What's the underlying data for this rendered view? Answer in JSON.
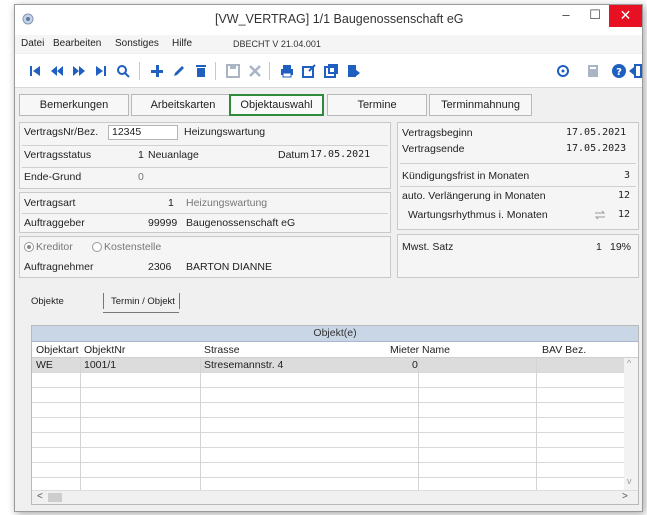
{
  "window": {
    "title": "[VW_VERTRAG]  1/1  Baugenossenschaft eG",
    "controls": {
      "minimize": "–",
      "maximize": "☐",
      "close": "✕"
    }
  },
  "menu": {
    "items": [
      "Datei",
      "Bearbeiten",
      "Sonstiges",
      "Hilfe"
    ],
    "version": "DBECHT V 21.04.001"
  },
  "toolbar": {
    "icons": [
      "first-record-icon",
      "previous-page-icon",
      "next-page-icon",
      "last-record-icon",
      "search-icon",
      "add-icon",
      "edit-icon",
      "delete-icon",
      "save-icon",
      "cancel-icon",
      "print-icon",
      "export-icon",
      "copy-icon",
      "import-icon",
      "refresh-icon",
      "calculator-icon",
      "help-icon",
      "exit-icon"
    ],
    "colors": {
      "primary": "#1f5fc0",
      "disabled": "#a9b4c4"
    }
  },
  "tabs": [
    {
      "label": "Bemerkungen",
      "active": false
    },
    {
      "label": "Arbeitskarten",
      "active": false
    },
    {
      "label": "Objektauswahl",
      "active": true
    },
    {
      "label": "Termine",
      "active": false
    },
    {
      "label": "Terminmahnung",
      "active": false
    }
  ],
  "contract": {
    "nr_label": "VertragsNr/Bez.",
    "nr_value": "12345",
    "bez_value": "Heizungswartung",
    "status_label": "Vertragsstatus",
    "status_code": "1",
    "status_text": "Neuanlage",
    "datum_label": "Datum",
    "datum_value": "17.05.2021",
    "ende_label": "Ende-Grund",
    "ende_value": "0",
    "art_label": "Vertragsart",
    "art_code": "1",
    "art_text": "Heizungswartung",
    "auftraggeber_label": "Auftraggeber",
    "auftraggeber_code": "99999",
    "auftraggeber_text": "Baugenossenschaft eG",
    "kreditor_label": "Kreditor",
    "kostenstelle_label": "Kostenstelle",
    "auftragnehmer_label": "Auftragnehmer",
    "auftragnehmer_code": "2306",
    "auftragnehmer_text": "BARTON DIANNE"
  },
  "terms": {
    "beginn_label": "Vertragsbeginn",
    "beginn_value": "17.05.2021",
    "ende_label": "Vertragsende",
    "ende_value": "17.05.2023",
    "kuendigung_label": "Kündigungsfrist in Monaten",
    "kuendigung_value": "3",
    "verlaengerung_label": "auto. Verlängerung in Monaten",
    "verlaengerung_value": "12",
    "rhythmus_label": "Wartungsrhythmus i. Monaten",
    "rhythmus_value": "12",
    "mwst_label": "Mwst. Satz",
    "mwst_code": "1",
    "mwst_value": "19%"
  },
  "subtabs": [
    {
      "label": "Objekte",
      "active": true
    },
    {
      "label": "Termin / Objekt",
      "active": false
    }
  ],
  "grid": {
    "caption": "Objekt(e)",
    "columns": [
      "Objektart",
      "ObjektNr",
      "Strasse",
      "Mieter",
      "Name",
      "BAV Bez."
    ],
    "rows": [
      {
        "objektart": "WE",
        "objektnr": "1001/1",
        "strasse": "Stresemannstr. 4",
        "mieter": "0",
        "name": "",
        "bav": ""
      }
    ],
    "scroll_left": "<",
    "scroll_right": ">",
    "scroll_up": "^",
    "scroll_down": "v"
  }
}
